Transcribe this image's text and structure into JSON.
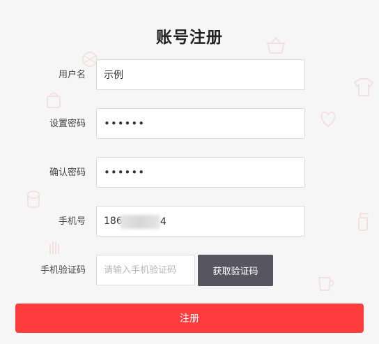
{
  "form": {
    "title": "账号注册",
    "username": {
      "label": "用户名",
      "value": "示例"
    },
    "password": {
      "label": "设置密码",
      "value": "••••••"
    },
    "confirm_password": {
      "label": "确认密码",
      "value": "••••••"
    },
    "phone": {
      "label": "手机号",
      "value_prefix": "186",
      "value_suffix": "4"
    },
    "verification": {
      "label": "手机验证码",
      "placeholder": "请输入手机验证码",
      "button_label": "获取验证码"
    },
    "submit_label": "注册"
  },
  "colors": {
    "background": "#f6f6f7",
    "submit": "#ff3d3f",
    "get_code_button": "#565560",
    "doodle": "#f2cfd3"
  },
  "decorations": [
    "ornament-icon",
    "heart-icon",
    "basket-icon",
    "shirt-icon",
    "toilet-paper-icon",
    "hand-icon",
    "bag-icon",
    "cup-icon",
    "spray-icon"
  ]
}
